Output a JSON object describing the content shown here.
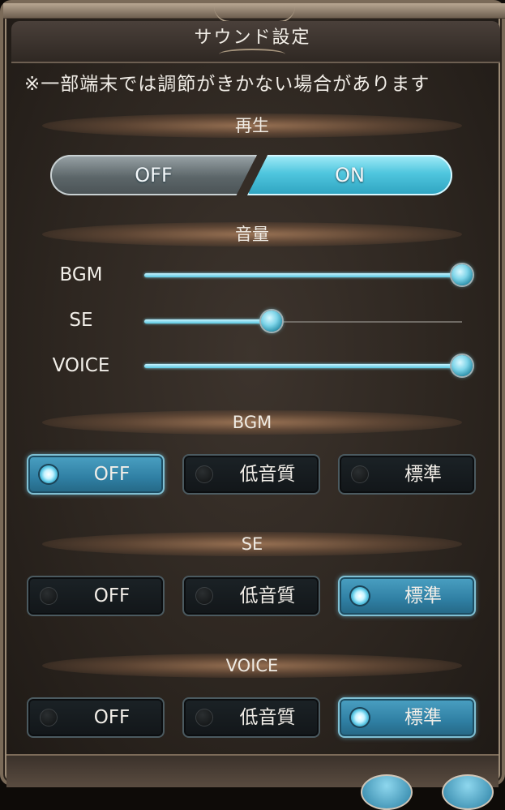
{
  "title": "サウンド設定",
  "note": "※一部端末では調節がきかない場合があります",
  "playback": {
    "header": "再生",
    "off_label": "OFF",
    "on_label": "ON",
    "selected": "ON"
  },
  "volume": {
    "header": "音量",
    "sliders": [
      {
        "label": "BGM",
        "value": 1.0
      },
      {
        "label": "SE",
        "value": 0.4
      },
      {
        "label": "VOICE",
        "value": 1.0
      }
    ]
  },
  "quality_groups": [
    {
      "header": "BGM",
      "options": [
        "OFF",
        "低音質",
        "標準"
      ],
      "selected": "OFF"
    },
    {
      "header": "SE",
      "options": [
        "OFF",
        "低音質",
        "標準"
      ],
      "selected": "標準"
    },
    {
      "header": "VOICE",
      "options": [
        "OFF",
        "低音質",
        "標準"
      ],
      "selected": "標準"
    }
  ],
  "colors": {
    "accent": "#4fc6de",
    "panel": "#2d2620"
  }
}
